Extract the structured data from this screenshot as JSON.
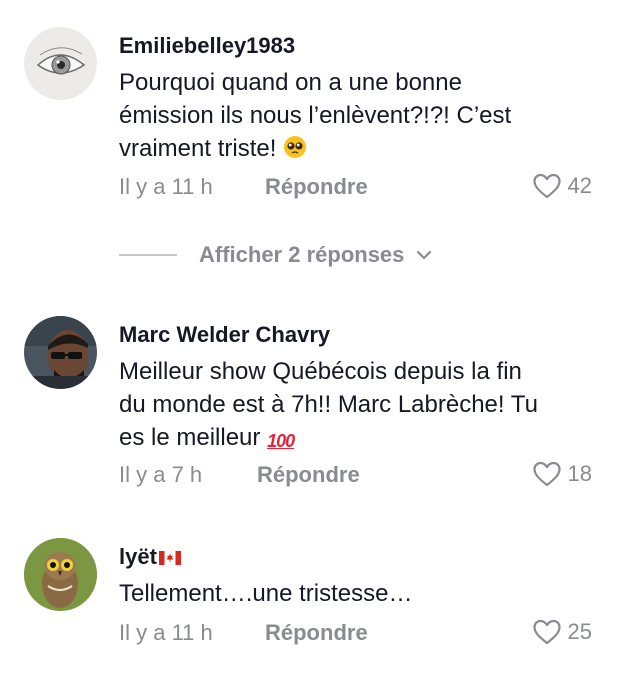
{
  "comments": [
    {
      "username": "Emiliebelley1983",
      "text_lines": [
        "Pourquoi quand on a une bonne",
        "émission ils nous l’enlèvent?!?! C’est",
        "vraiment triste! "
      ],
      "time": "Il y a 11 h",
      "reply_label": "Répondre",
      "likes": "42",
      "avatar_icon": "eye-sketch-avatar",
      "emoji": "pleading-face-emoji"
    },
    {
      "username": "Marc Welder Chavry",
      "text_lines": [
        "Meilleur show Québécois depuis la fin",
        "du monde est à 7h!! Marc Labrèche! Tu",
        "es le meilleur "
      ],
      "time": "Il y a 7 h",
      "reply_label": "Répondre",
      "likes": "18",
      "avatar_icon": "man-sunglasses-avatar",
      "emoji": "hundred-points-emoji",
      "emoji_text": "100"
    },
    {
      "username": "lyët",
      "text_lines": [
        "Tellement….une tristesse…"
      ],
      "time": "Il y a 11 h",
      "reply_label": "Répondre",
      "likes": "25",
      "avatar_icon": "owl-avatar",
      "flag": "canada-flag-icon"
    }
  ],
  "view_replies": {
    "label": "Afficher 2 réponses"
  },
  "colors": {
    "text": "#161823",
    "muted": "#8a8b91",
    "divider": "#c9c9cc"
  }
}
